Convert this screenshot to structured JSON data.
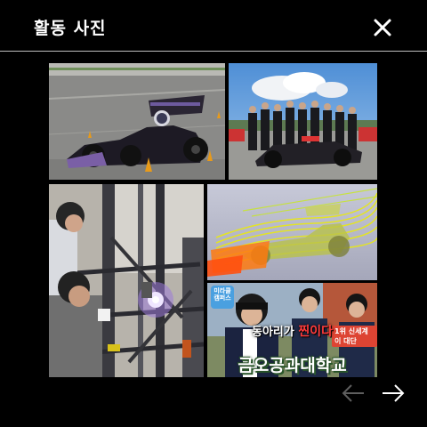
{
  "header": {
    "title": "활동 사진"
  },
  "icons": {
    "close": "close-icon",
    "prev": "arrow-left-icon",
    "next": "arrow-right-icon"
  },
  "gallery": {
    "photos": [
      {
        "subject": "formula race car on asphalt track"
      },
      {
        "subject": "team group photo with race car"
      },
      {
        "subject": "students welding a car frame"
      },
      {
        "subject": "CFD airflow simulation of race car"
      },
      {
        "subject": "TV program thumbnail with students"
      }
    ],
    "overlay": {
      "tag": "미라클 캠퍼스",
      "banner": "1위 신세계 이 대단",
      "sub_prefix": "동아리가 ",
      "sub_highlight": "찐이다",
      "main": "금오공과대학교"
    }
  },
  "colors": {
    "background": "#000000",
    "nav_prev": "#5e5e5e",
    "nav_next": "#ffffff"
  }
}
